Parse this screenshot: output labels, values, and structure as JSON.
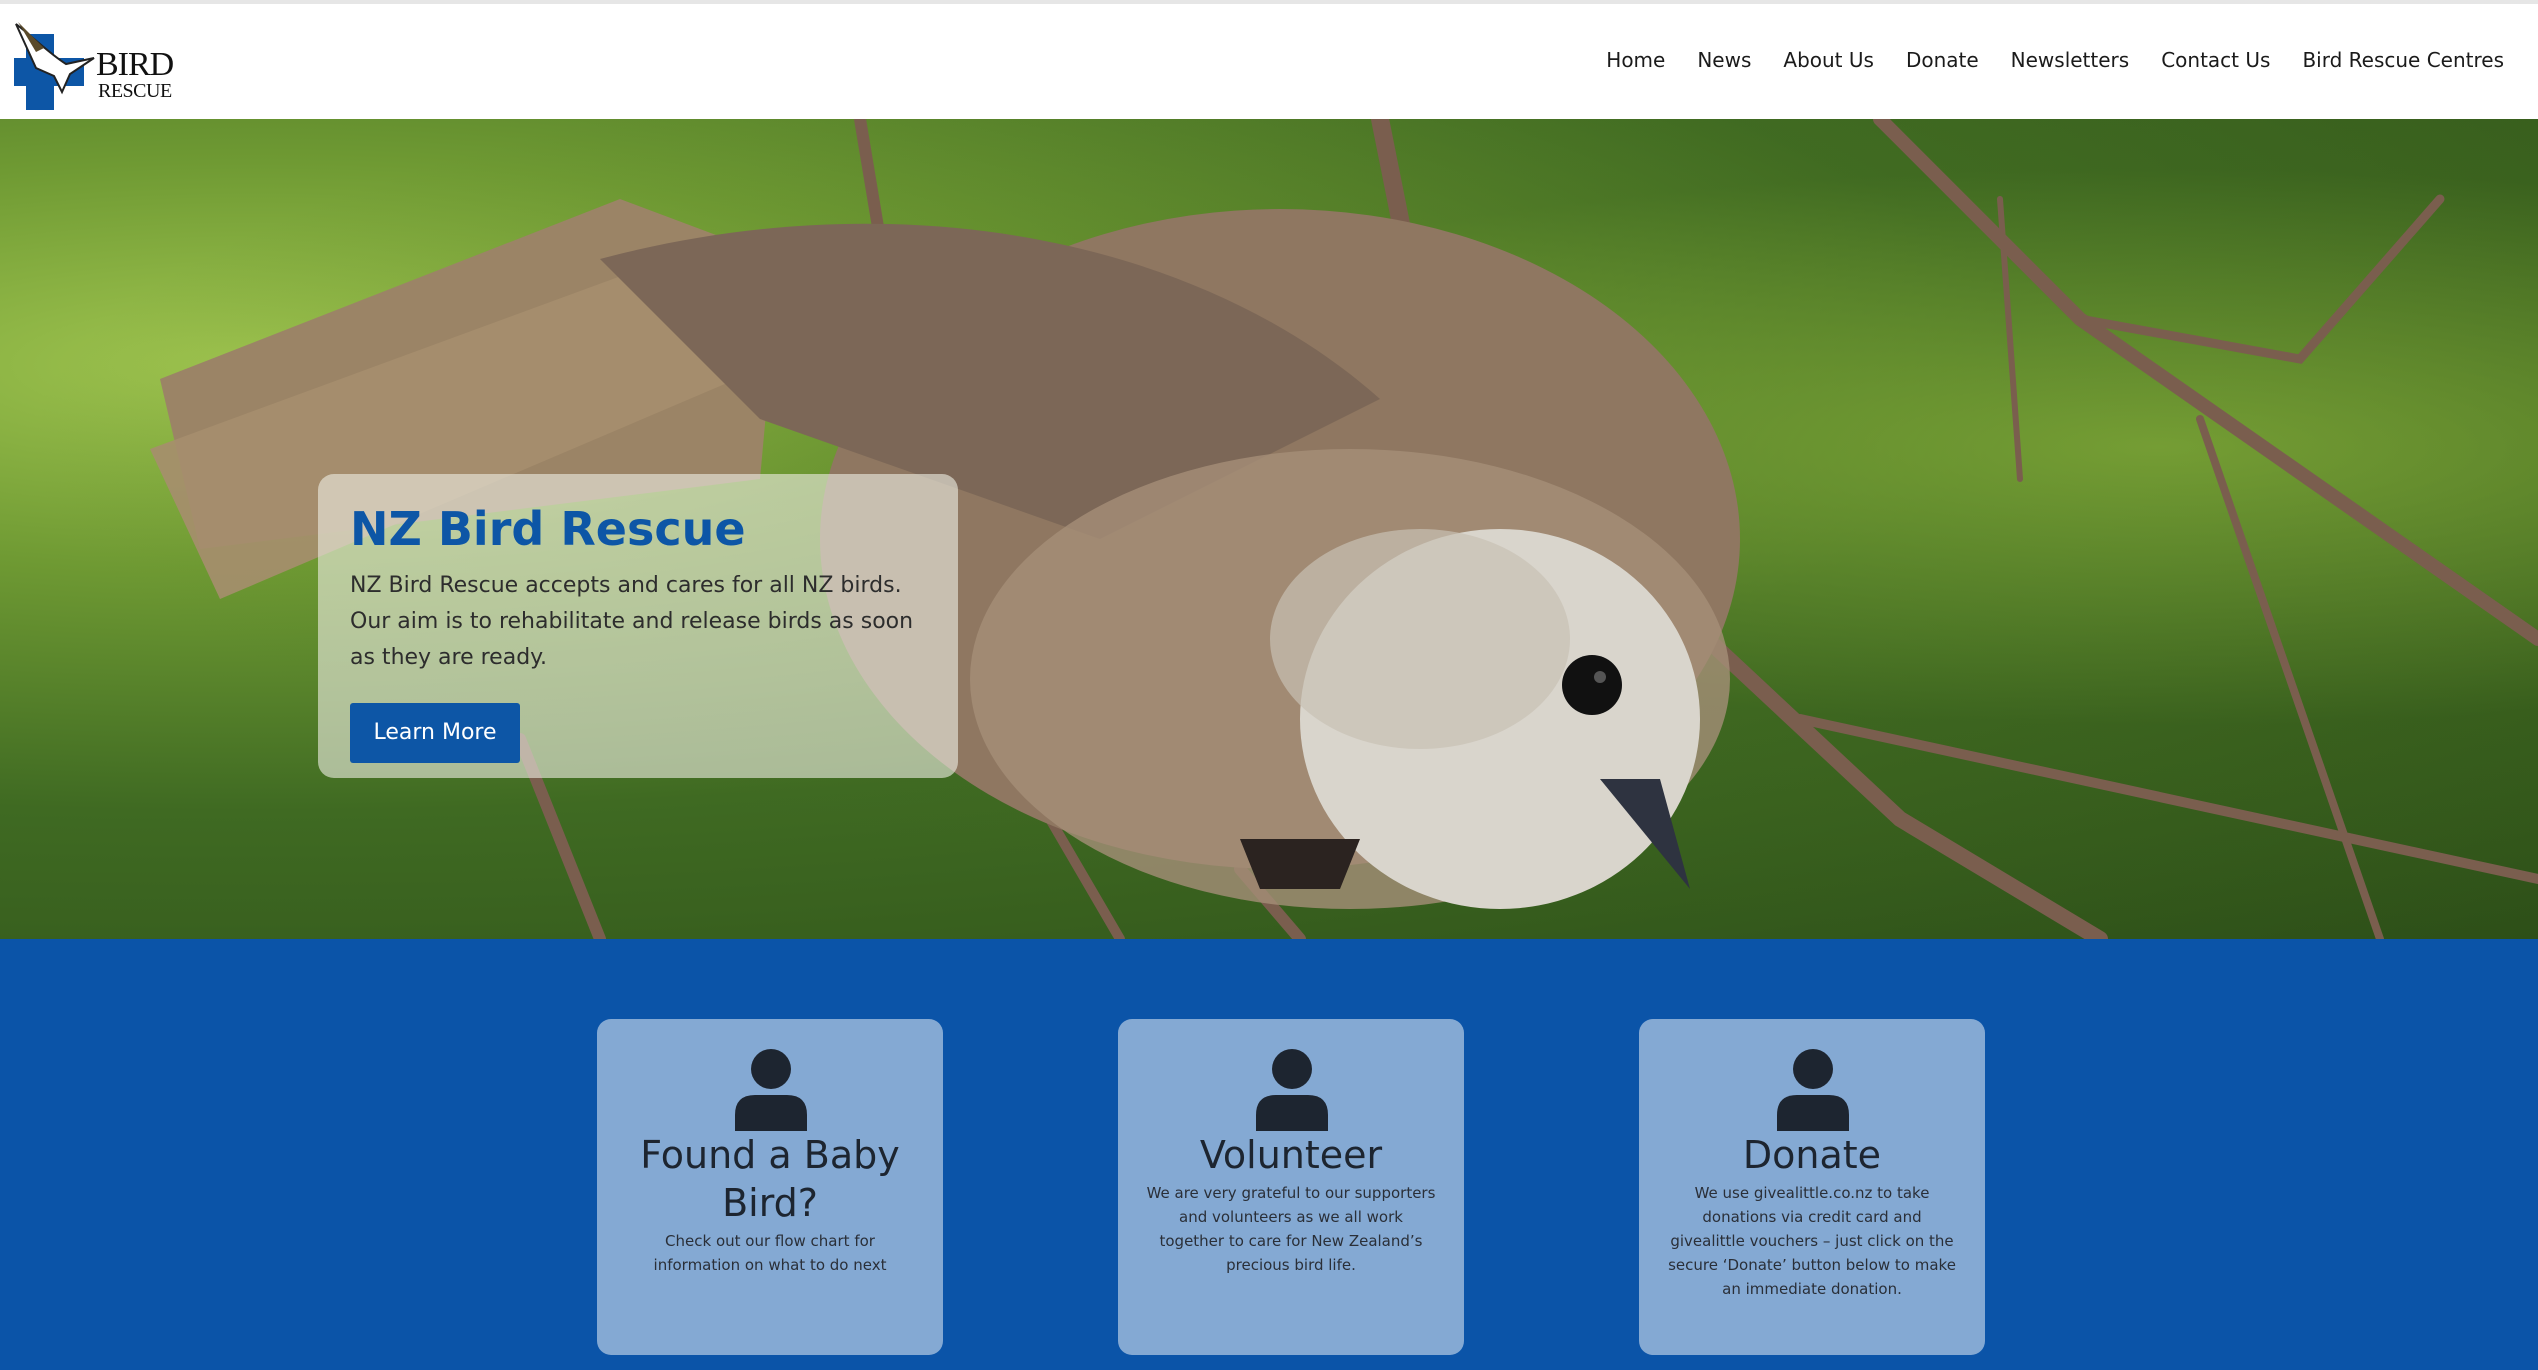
{
  "header": {
    "logo": {
      "line1": "BIRD",
      "line2": "RESCUE",
      "icon": "bird-cross-logo"
    },
    "nav": [
      "Home",
      "News",
      "About Us",
      "Donate",
      "Newsletters",
      "Contact Us",
      "Bird Rescue Centres"
    ]
  },
  "hero": {
    "title": "NZ Bird Rescue",
    "text": "NZ Bird Rescue accepts and cares for all NZ birds. Our aim is to rehabilitate and release birds as soon as they are ready.",
    "button": "Learn More"
  },
  "cards": [
    {
      "title": "Found a Baby Bird?",
      "text": "Check out our flow chart for information on what to do next",
      "icon": "user-icon"
    },
    {
      "title": "Volunteer",
      "text": "We are very grateful to our supporters and volunteers as we all work together to care for New Zealand’s precious bird life.",
      "icon": "user-icon"
    },
    {
      "title": "Donate",
      "text": "We use givealittle.co.nz to take donations via credit card and givealittle vouchers – just click on the secure ‘Donate’ button below to make an immediate donation.",
      "icon": "user-icon"
    }
  ],
  "colors": {
    "brand_blue": "#0b54a8",
    "card_bg": "#84a9d3",
    "title_blue": "#0d56a6"
  }
}
